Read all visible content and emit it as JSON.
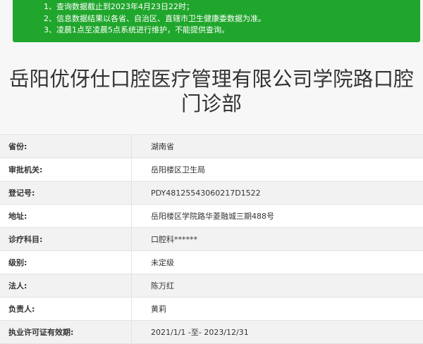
{
  "notice": {
    "lines": [
      "1、查询数据截止到2023年4月23日22时；",
      "2、信息数据结果以各省、自治区、直辖市卫生健康委数据为准。",
      "3、凌晨1点至凌晨5点系统进行维护，不能提供查询。"
    ]
  },
  "title": {
    "line1": "岳阳优伢仕口腔医疗管理有限公司学院路口腔",
    "line2": "门诊部"
  },
  "details": [
    {
      "label": "省份:",
      "value": "湖南省"
    },
    {
      "label": "审批机关:",
      "value": "岳阳楼区卫生局"
    },
    {
      "label": "登记号:",
      "value": "PDY48125543060217D1522"
    },
    {
      "label": "地址:",
      "value": "岳阳楼区学院路华菱融城三期488号"
    },
    {
      "label": "诊疗科目:",
      "value": "口腔科******"
    },
    {
      "label": "级别:",
      "value": "未定级"
    },
    {
      "label": "法人:",
      "value": "陈万红"
    },
    {
      "label": "负责人:",
      "value": "黄莉"
    },
    {
      "label": "执业许可证有效期:",
      "value": "2021/1/1 -至- 2023/12/31"
    }
  ],
  "colors": {
    "notice_bg": "#20a62c",
    "row_alt": "#f2f2f2",
    "border": "#e3e3e3"
  }
}
